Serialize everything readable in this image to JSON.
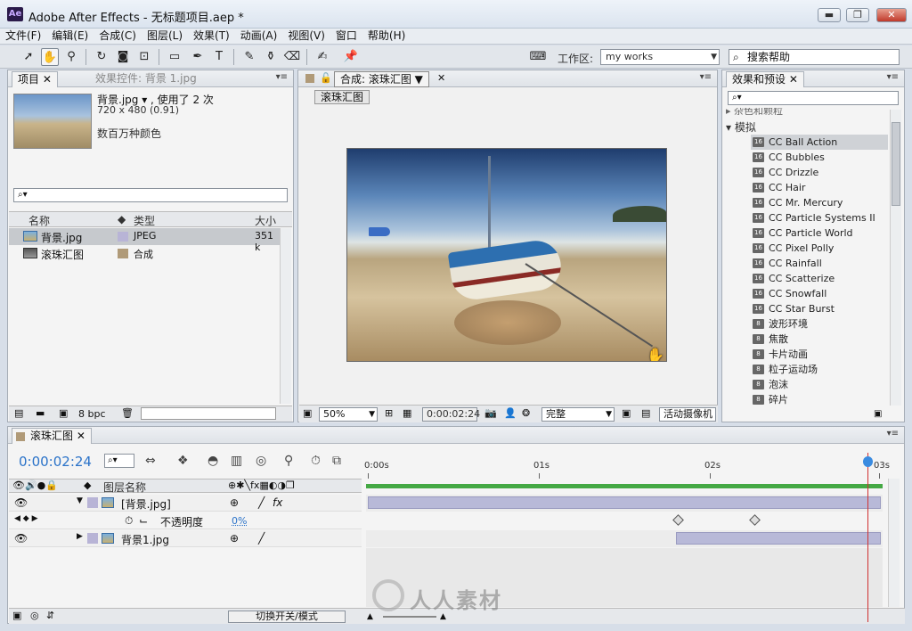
{
  "app": {
    "icon_label": "Ae",
    "title": "Adobe After Effects - 无标题项目.aep *"
  },
  "menu": [
    "文件(F)",
    "编辑(E)",
    "合成(C)",
    "图层(L)",
    "效果(T)",
    "动画(A)",
    "视图(V)",
    "窗口",
    "帮助(H)"
  ],
  "toolbar": {
    "workspace_label": "工作区:",
    "workspace_value": "my works",
    "help_search": "搜索帮助"
  },
  "project_panel": {
    "tab_project": "项目",
    "tab_effect_controls": "效果控件: 背景 1.jpg",
    "selected_name": "背景.jpg ▾ , 使用了 2 次",
    "selected_dims": "720 x 480 (0.91)",
    "selected_color": "数百万种颜色",
    "search_placeholder": "⌕▾",
    "col_name": "名称",
    "col_type": "类型",
    "col_size": "大小",
    "items": [
      {
        "name": "背景.jpg",
        "type": "JPEG",
        "size": "351 k",
        "swatch": "#b8b4d6"
      },
      {
        "name": "滚珠汇图",
        "type": "合成",
        "size": "",
        "swatch": "#b09a78"
      }
    ],
    "bpc": "8 bpc"
  },
  "comp_panel": {
    "tab_label": "合成: 滚珠汇图",
    "comp_button": "滚珠汇图",
    "zoom": "50%",
    "timecode": "0:00:02:24",
    "resolution": "完整",
    "camera": "活动摄像机"
  },
  "effects_panel": {
    "tab_label": "效果和预设",
    "category_partial": "杂色和颗粒",
    "category": "模拟",
    "items": [
      "CC Ball Action",
      "CC Bubbles",
      "CC Drizzle",
      "CC Hair",
      "CC Mr. Mercury",
      "CC Particle Systems II",
      "CC Particle World",
      "CC Pixel Polly",
      "CC Rainfall",
      "CC Scatterize",
      "CC Snowfall",
      "CC Star Burst",
      "波形环境",
      "焦散",
      "卡片动画",
      "粒子运动场",
      "泡沫",
      "碎片"
    ]
  },
  "timeline": {
    "tab_label": "滚珠汇图",
    "current_time": "0:00:02:24",
    "col_layer_name": "图层名称",
    "ticks": [
      "0:00s",
      "01s",
      "02s",
      "03s"
    ],
    "layers": [
      {
        "name": "[背景.jpg]",
        "has_fx": true
      },
      {
        "name": "背景1.jpg",
        "has_fx": false
      }
    ],
    "property": {
      "name": "不透明度",
      "value": "0%"
    },
    "toggle_modes": "切换开关/模式",
    "watermark": "人人素材"
  }
}
